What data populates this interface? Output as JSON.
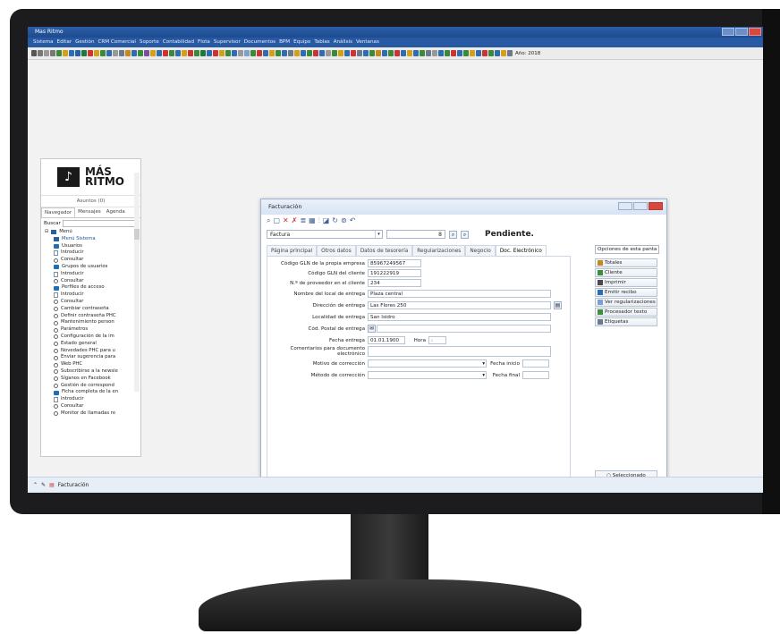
{
  "app": {
    "title": "Mas Ritmo"
  },
  "menu": [
    "Sistema",
    "Editar",
    "Gestión",
    "CRM Comercial",
    "Soporte",
    "Contabilidad",
    "Flota",
    "Supervisor",
    "Documentos",
    "BPM",
    "Equipo",
    "Tablas",
    "Análisis",
    "Ventanas"
  ],
  "toolbar": {
    "year_label": "Año: 2018"
  },
  "status": {
    "window_label": "Facturación"
  },
  "nav": {
    "logo_line1": "MÁS",
    "logo_line2": "RITMO",
    "asuntos": "Asuntos (0)",
    "tabs": [
      "Navegador",
      "Mensajes",
      "Agenda"
    ],
    "search_label": "Buscar",
    "root": "Menú",
    "items": [
      {
        "icon": "menu",
        "label": "Menú Sistema",
        "strong": true
      },
      {
        "icon": "folder",
        "label": "Usuarios"
      },
      {
        "icon": "doc",
        "label": "Introducir"
      },
      {
        "icon": "circ",
        "label": "Consultar"
      },
      {
        "icon": "folder",
        "label": "Grupos de usuarios"
      },
      {
        "icon": "doc",
        "label": "Introducir"
      },
      {
        "icon": "circ",
        "label": "Consultar"
      },
      {
        "icon": "folder",
        "label": "Perfiles de acceso"
      },
      {
        "icon": "doc",
        "label": "Introducir"
      },
      {
        "icon": "circ",
        "label": "Consultar"
      },
      {
        "icon": "circ",
        "label": "Cambiar contraseña"
      },
      {
        "icon": "circ",
        "label": "Definir contraseña PHC"
      },
      {
        "icon": "circ",
        "label": "Mantenimiento person"
      },
      {
        "icon": "circ",
        "label": "Parámetros"
      },
      {
        "icon": "circ",
        "label": "Configuración de la im"
      },
      {
        "icon": "circ",
        "label": "Estado general"
      },
      {
        "icon": "circ",
        "label": "Novedades PHC para u"
      },
      {
        "icon": "circ",
        "label": "Enviar sugerencia para"
      },
      {
        "icon": "circ",
        "label": "Web PHC"
      },
      {
        "icon": "circ",
        "label": "Subscribirse a la newsle"
      },
      {
        "icon": "circ",
        "label": "Síganos en Facebook"
      },
      {
        "icon": "circ",
        "label": "Gestión de correspond"
      },
      {
        "icon": "folder",
        "label": "Ficha completa de la en"
      },
      {
        "icon": "doc",
        "label": "Introducir"
      },
      {
        "icon": "circ",
        "label": "Consultar"
      },
      {
        "icon": "circ",
        "label": "Monitor de llamadas re"
      }
    ]
  },
  "dialog": {
    "title": "Facturación",
    "doc_type": "Factura",
    "number": "8",
    "status": "Pendiente.",
    "tabs": [
      "Página principal",
      "Otros datos",
      "Datos de tesorería",
      "Regularizaciones",
      "Negocio",
      "Doc. Electrónico"
    ],
    "options_label": "Opciones de esta panta",
    "fields": {
      "gln_empresa_label": "Código GLN de la propia empresa",
      "gln_empresa": "85967249567",
      "gln_cliente_label": "Código GLN del cliente",
      "gln_cliente": "191222919",
      "proveedor_label": "N.º de proveedor en el cliente",
      "proveedor": "234",
      "local_label": "Nombre del local de entrega",
      "local": "Plaza central",
      "direccion_label": "Dirección de entrega",
      "direccion": "Las Flores 250",
      "localidad_label": "Localidad de entrega",
      "localidad": "San Isidro",
      "postal_label": "Cód. Postal de entrega",
      "fecha_label": "Fecha entrega",
      "fecha": "01.01.1900",
      "hora_label": "Hora",
      "hora": ":",
      "comentarios_label": "Comentarios para documento electrónico",
      "motivo_label": "Motivo de corrección",
      "metodo_label": "Método de corrección",
      "inicio_label": "Fecha inicio",
      "final_label": "Fecha final"
    },
    "side_buttons": [
      {
        "label": "Totales",
        "color": "#c58a1e"
      },
      {
        "label": "Cliente",
        "color": "#3d8f3d"
      },
      {
        "label": "Imprimir",
        "color": "#4a4a4a"
      },
      {
        "label": "Emitir recibo",
        "color": "#2f6db3"
      },
      {
        "label": "Ver regularizaciones",
        "color": "#7aa0d6"
      },
      {
        "label": "Procesador texto",
        "color": "#3d8f3d"
      },
      {
        "label": "Etiquetas",
        "color": "#6a7a8c"
      }
    ],
    "selected_label": "Seleccionado"
  }
}
